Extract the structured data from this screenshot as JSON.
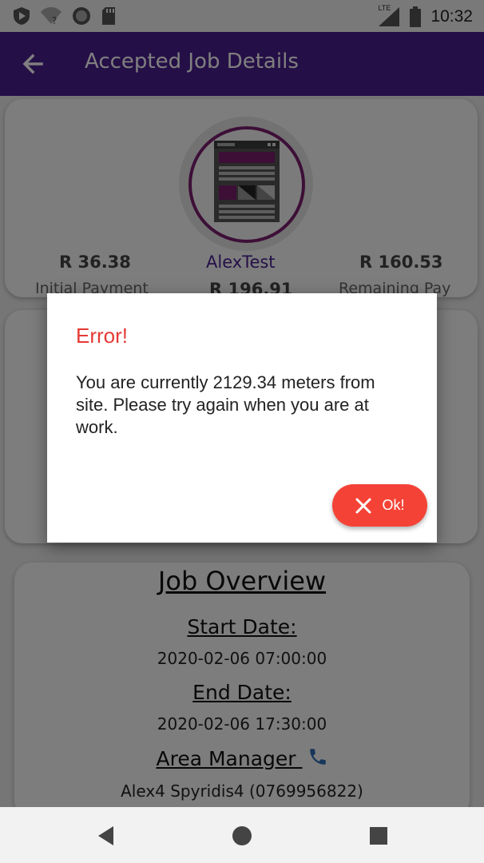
{
  "status_bar": {
    "time": "10:32",
    "network_label": "LTE",
    "icons": [
      "shield-icon",
      "wifi-question-icon",
      "record-icon",
      "sd-card-icon",
      "signal-icon",
      "battery-icon"
    ]
  },
  "app_bar": {
    "title": "Accepted Job Details",
    "back_icon": "arrow-left-icon",
    "color": "#4b1f8f"
  },
  "job_card": {
    "name": "AlexTest",
    "initial_payment": {
      "amount": "R 36.38",
      "label": "Initial Payment"
    },
    "total": "R 196.91",
    "remaining": {
      "amount": "R 160.53",
      "label": "Remaining Pay"
    }
  },
  "overview": {
    "title": "Job Overview",
    "start_label": "Start Date:",
    "start_value": "2020-02-06 07:00:00",
    "end_label": "End Date:",
    "end_value": "2020-02-06 17:30:00",
    "manager_label": "Area Manager",
    "manager_value": "Alex4 Spyridis4 (0769956822)"
  },
  "dialog": {
    "title": "Error!",
    "message": "You are currently 2129.34 meters from site. Please try again when you are at work.",
    "ok_label": "Ok!",
    "accent": "#f44336"
  },
  "nav_bar": {
    "icons": [
      "back-triangle-icon",
      "home-circle-icon",
      "recents-square-icon"
    ]
  }
}
